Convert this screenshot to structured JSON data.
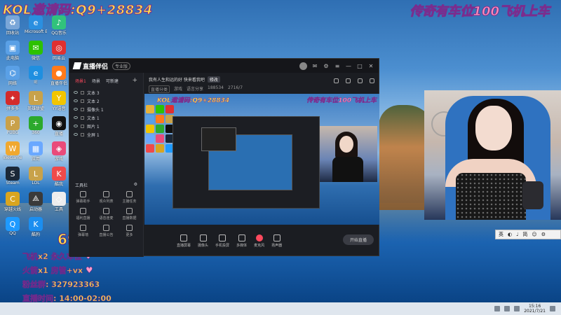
{
  "overlay": {
    "top_left": "KOL邀请码:Q9+28834",
    "top_right": "传奇有车位100飞机上车",
    "big_number": "696"
  },
  "promo": {
    "line1": "飞机x2 永久车位",
    "line2": "火箭x1 房管+vx",
    "line3": "粉丝群: 327923363",
    "line4": "直播时间: 14:00-02:00"
  },
  "desktop_icons": [
    {
      "name": "recycle-bin-icon",
      "label": "回收站",
      "color": "#7aa6d8",
      "glyph": "♻"
    },
    {
      "name": "mic-icon",
      "label": "Microsoft Edge",
      "color": "#2a8fe0",
      "glyph": "e"
    },
    {
      "name": "qq-music-icon",
      "label": "QQ音乐",
      "color": "#31c27c",
      "glyph": "♪"
    },
    {
      "name": "computer-icon",
      "label": "此电脑",
      "color": "#5aa0e6",
      "glyph": "▣"
    },
    {
      "name": "wechat-icon",
      "label": "微信",
      "color": "#2dc100",
      "glyph": "✉"
    },
    {
      "name": "netease-icon",
      "label": "网易云",
      "color": "#e03030",
      "glyph": "◎"
    },
    {
      "name": "network-icon",
      "label": "网络",
      "color": "#5aa0e6",
      "glyph": "⌬"
    },
    {
      "name": "ie-icon",
      "label": "IE",
      "color": "#1f8fe0",
      "glyph": "e"
    },
    {
      "name": "obs-icon",
      "label": "直播伴侣",
      "color": "#ff7a1a",
      "glyph": "●"
    },
    {
      "name": "pdd-icon",
      "label": "拼多多",
      "color": "#d42b2b",
      "glyph": "✦"
    },
    {
      "name": "league-icon",
      "label": "英雄联盟",
      "color": "#c8a24a",
      "glyph": "L"
    },
    {
      "name": "yy-icon",
      "label": "YY语音",
      "color": "#f2c500",
      "glyph": "Y"
    },
    {
      "name": "pubg-icon",
      "label": "PUBG",
      "color": "#c9a14a",
      "glyph": "P"
    },
    {
      "name": "plus-icon",
      "label": "360",
      "color": "#2ca92c",
      "glyph": "+"
    },
    {
      "name": "live-icon",
      "label": "直播",
      "color": "#111111",
      "glyph": "◉"
    },
    {
      "name": "steam-small-icon",
      "label": "WeGame",
      "color": "#f0a830",
      "glyph": "W"
    },
    {
      "name": "apps-icon",
      "label": "应用",
      "color": "#6aa8ff",
      "glyph": "▦"
    },
    {
      "name": "game-icon",
      "label": "游戏",
      "color": "#e94b7a",
      "glyph": "◈"
    },
    {
      "name": "steam-icon",
      "label": "Steam",
      "color": "#1b2838",
      "glyph": "S"
    },
    {
      "name": "lol-icon",
      "label": "LOL",
      "color": "#c8a24a",
      "glyph": "L"
    },
    {
      "name": "kuwo-icon",
      "label": "酷我",
      "color": "#f04a4a",
      "glyph": "K"
    },
    {
      "name": "cf-icon",
      "label": "穿越火线",
      "color": "#d9a520",
      "glyph": "C"
    },
    {
      "name": "launcher-icon",
      "label": "启动器",
      "color": "#3a3a3a",
      "glyph": "⟁"
    },
    {
      "name": "app-icon",
      "label": "工具",
      "color": "#ededed",
      "glyph": "◇"
    },
    {
      "name": "qq-icon",
      "label": "QQ",
      "color": "#1e9aff",
      "glyph": "Q"
    },
    {
      "name": "kugou-icon",
      "label": "酷狗",
      "color": "#1b8ef0",
      "glyph": "K"
    }
  ],
  "live_window": {
    "app_name": "直播伴侣",
    "badge": "专业版",
    "tabs": [
      "场景1",
      "场景",
      "可新建"
    ],
    "scenes": [
      "文本 3",
      "文本 2",
      "摄像头 1",
      "文本 1",
      "图片 1",
      "全屏 1"
    ],
    "tools_label": "工具栏",
    "tools": [
      "弹幕助手",
      "观众列表",
      "主播任务",
      "福利直播",
      "语音连麦",
      "直播数据",
      "弹幕墙",
      "直播公告",
      "更多"
    ],
    "room_title": "我有人生和远的好 快来看我吧",
    "room_edit": "修改",
    "room_meta": [
      "直播分类",
      "游戏",
      "语言分享",
      "188534",
      "2716/7"
    ],
    "preview_left": "KOL邀请码:Q9+28834",
    "preview_right": "传奇有车位100飞机上车",
    "bottom_items": [
      "直播屏幕",
      "摄像头",
      "手机投屏",
      "多媒体",
      "麦克风",
      "扬声器"
    ],
    "start_label": "开始直播"
  },
  "ime": [
    "英",
    "◐",
    "♩",
    "简",
    "☺",
    "⚙"
  ],
  "taskbar": {
    "time": "15:16",
    "date": "2021/7/21"
  }
}
